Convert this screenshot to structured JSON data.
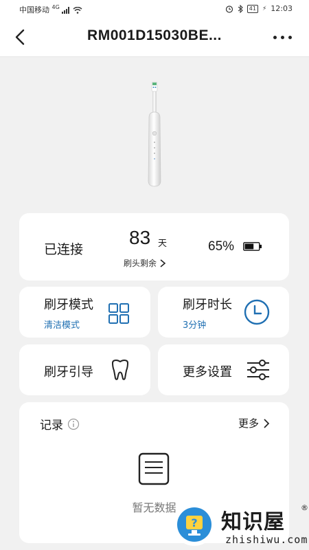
{
  "status_bar": {
    "carrier": "中国移动",
    "network": "4G",
    "battery_level": "41",
    "time": "12:03"
  },
  "nav": {
    "title": "RM001D15030BE..."
  },
  "device_status": {
    "connection": "已连接",
    "days_remaining": "83",
    "days_unit": "天",
    "head_remaining_label": "刷头剩余",
    "battery_percent": "65%",
    "battery_fill_fraction": 0.65
  },
  "tiles": {
    "mode": {
      "title": "刷牙模式",
      "value": "清洁模式",
      "icon": "grid-icon"
    },
    "duration": {
      "title": "刷牙时长",
      "value": "3分钟",
      "icon": "clock-icon"
    },
    "guide": {
      "title": "刷牙引导",
      "icon": "tooth-icon"
    },
    "settings": {
      "title": "更多设置",
      "icon": "sliders-icon"
    }
  },
  "records": {
    "title": "记录",
    "more_label": "更多",
    "empty_text": "暂无数据"
  },
  "watermark": {
    "name": "知识屋",
    "registered_mark": "®",
    "domain": "zhishiwu.com"
  },
  "colors": {
    "accent": "#1f6fb2",
    "background": "#f1f1f1",
    "card": "#ffffff"
  }
}
